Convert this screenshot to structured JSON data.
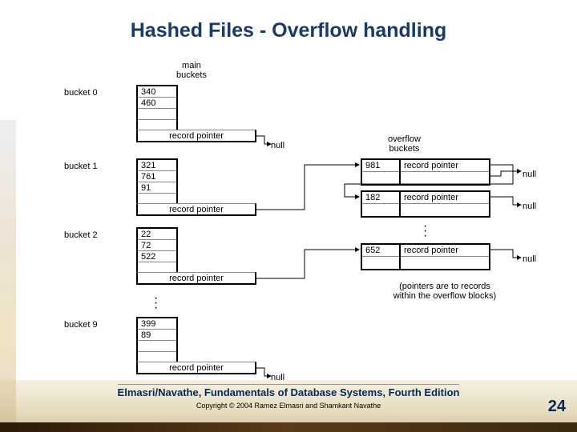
{
  "title": "Hashed Files - Overflow handling",
  "labels": {
    "main_buckets": "main\nbuckets",
    "overflow_buckets": "overflow\nbuckets",
    "bucket0": "bucket 0",
    "bucket1": "bucket 1",
    "bucket2": "bucket 2",
    "bucket9": "bucket 9",
    "record_pointer": "record pointer",
    "null_text": "null",
    "overflow_note": "(pointers are to records\nwithin the overflow blocks)"
  },
  "main_buckets": {
    "b0": [
      "340",
      "460",
      "",
      ""
    ],
    "b1": [
      "321",
      "761",
      "91",
      ""
    ],
    "b2": [
      "22",
      "72",
      "522",
      ""
    ],
    "b9": [
      "399",
      "89",
      "",
      ""
    ]
  },
  "overflow": {
    "r981": [
      "981",
      "record pointer"
    ],
    "r182": [
      "182",
      "record pointer"
    ],
    "r652": [
      "652",
      "record pointer"
    ]
  },
  "chart_data": {
    "type": "diagram",
    "title": "Hashed Files - Overflow handling",
    "main_buckets_label": "main buckets",
    "overflow_buckets_label": "overflow buckets",
    "buckets": [
      {
        "name": "bucket 0",
        "records": [
          340,
          460
        ],
        "capacity": 4,
        "overflow_pointer": null
      },
      {
        "name": "bucket 1",
        "records": [
          321,
          761,
          91
        ],
        "capacity": 4,
        "overflow_pointer": 981
      },
      {
        "name": "bucket 2",
        "records": [
          22,
          72,
          522
        ],
        "capacity": 4,
        "overflow_pointer": 652
      },
      {
        "name": "...",
        "records": [],
        "capacity": 0,
        "overflow_pointer": null
      },
      {
        "name": "bucket 9",
        "records": [
          399,
          89
        ],
        "capacity": 4,
        "overflow_pointer": null
      }
    ],
    "overflow_records": [
      {
        "key": 981,
        "next": 182
      },
      {
        "key": 182,
        "next": null
      },
      {
        "key": 652,
        "next": null
      }
    ],
    "note": "(pointers are to records within the overflow blocks)",
    "pointer_label": "record pointer",
    "null_label": "null"
  },
  "footer": {
    "credit": "Elmasri/Navathe, Fundamentals of Database Systems, Fourth Edition",
    "copyright": "Copyright © 2004 Ramez Elmasri and Shamkant Navathe"
  },
  "page_number": "24"
}
